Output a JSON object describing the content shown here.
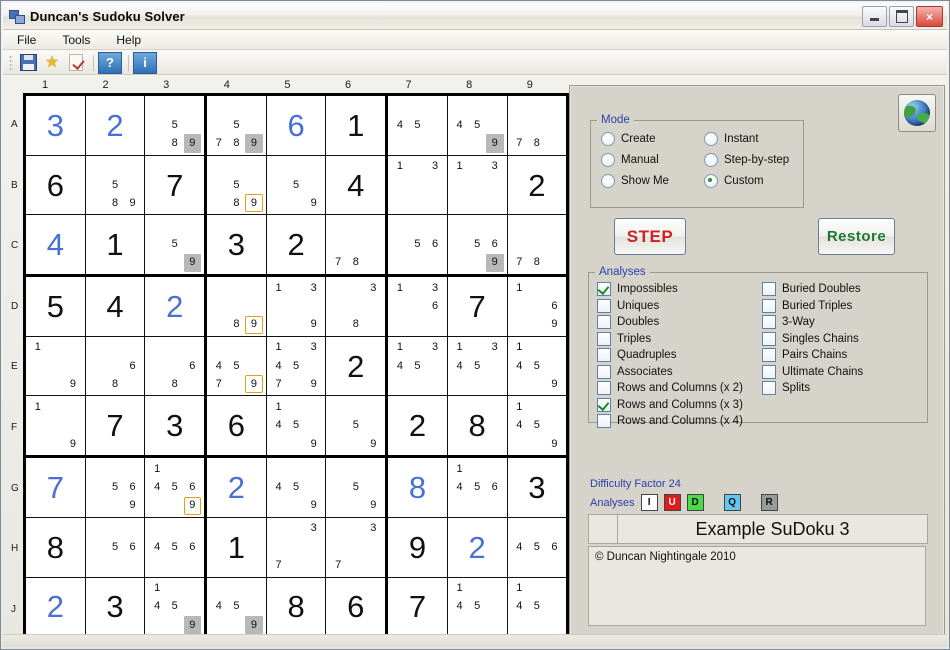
{
  "window": {
    "title": "Duncan's Sudoku Solver",
    "icon": "app-icon",
    "minimize": "minimize",
    "maximize": "maximize",
    "close": "×"
  },
  "menu": {
    "items": [
      {
        "label": "File"
      },
      {
        "label": "Tools"
      },
      {
        "label": "Help"
      }
    ]
  },
  "toolbar": {
    "buttons": [
      {
        "name": "save-icon",
        "label": ""
      },
      {
        "name": "star-icon",
        "label": ""
      },
      {
        "name": "page-check-icon",
        "label": ""
      },
      {
        "name": "help-button",
        "label": "?"
      },
      {
        "name": "info-button",
        "label": "i"
      }
    ]
  },
  "grid": {
    "column_labels": [
      "1",
      "2",
      "3",
      "4",
      "5",
      "6",
      "7",
      "8",
      "9"
    ],
    "row_labels": [
      "A",
      "B",
      "C",
      "D",
      "E",
      "F",
      "G",
      "H",
      "J"
    ],
    "cells": [
      [
        {
          "value": "3",
          "given": true
        },
        {
          "value": "2",
          "given": true
        },
        {
          "candidates": {
            "5": "plain",
            "8": "plain",
            "9": "gray"
          }
        },
        {
          "candidates": {
            "5": "plain",
            "7": "plain",
            "8": "plain",
            "9": "gray"
          }
        },
        {
          "value": "6",
          "given": true
        },
        {
          "value": "1"
        },
        {
          "candidates": {
            "4": "plain",
            "5": "plain"
          }
        },
        {
          "candidates": {
            "4": "plain",
            "5": "plain",
            "9": "gray"
          }
        },
        {
          "candidates": {
            "7": "plain",
            "8": "plain"
          }
        }
      ],
      [
        {
          "value": "6"
        },
        {
          "candidates": {
            "5": "plain",
            "8": "plain",
            "9": "plain"
          }
        },
        {
          "value": "7"
        },
        {
          "candidates": {
            "5": "plain",
            "8": "plain",
            "9": "box"
          }
        },
        {
          "candidates": {
            "5": "plain",
            "9": "plain"
          }
        },
        {
          "value": "4"
        },
        {
          "candidates": {
            "1": "plain",
            "3": "plain"
          }
        },
        {
          "candidates": {
            "1": "plain",
            "3": "plain"
          }
        },
        {
          "value": "2"
        }
      ],
      [
        {
          "value": "4",
          "given": true
        },
        {
          "value": "1"
        },
        {
          "candidates": {
            "5": "plain",
            "9": "gray"
          }
        },
        {
          "value": "3"
        },
        {
          "value": "2"
        },
        {
          "candidates": {
            "7": "plain",
            "8": "plain"
          }
        },
        {
          "candidates": {
            "5": "plain",
            "6": "plain"
          }
        },
        {
          "candidates": {
            "5": "plain",
            "6": "plain",
            "9": "gray"
          }
        },
        {
          "candidates": {
            "7": "plain",
            "8": "plain"
          }
        }
      ],
      [
        {
          "value": "5"
        },
        {
          "value": "4"
        },
        {
          "value": "2",
          "given": true
        },
        {
          "candidates": {
            "8": "plain",
            "9": "box"
          }
        },
        {
          "candidates": {
            "1": "plain",
            "3": "plain",
            "9": "plain"
          }
        },
        {
          "candidates": {
            "3": "plain",
            "8": "plain"
          }
        },
        {
          "candidates": {
            "1": "plain",
            "3": "plain",
            "6": "plain"
          }
        },
        {
          "value": "7"
        },
        {
          "candidates": {
            "1": "plain",
            "6": "plain",
            "9": "plain"
          }
        }
      ],
      [
        {
          "candidates": {
            "1": "plain",
            "9": "plain"
          }
        },
        {
          "candidates": {
            "6": "plain",
            "8": "plain"
          }
        },
        {
          "candidates": {
            "6": "plain",
            "8": "plain"
          }
        },
        {
          "candidates": {
            "4": "plain",
            "5": "plain",
            "7": "plain",
            "9": "box"
          }
        },
        {
          "candidates": {
            "1": "plain",
            "3": "plain",
            "4": "plain",
            "5": "plain",
            "7": "plain",
            "9": "plain"
          }
        },
        {
          "value": "2"
        },
        {
          "candidates": {
            "1": "plain",
            "3": "plain",
            "4": "plain",
            "5": "plain"
          }
        },
        {
          "candidates": {
            "1": "plain",
            "3": "plain",
            "4": "plain",
            "5": "plain"
          }
        },
        {
          "candidates": {
            "1": "plain",
            "4": "plain",
            "5": "plain",
            "9": "plain"
          }
        }
      ],
      [
        {
          "candidates": {
            "1": "plain",
            "9": "plain"
          }
        },
        {
          "value": "7"
        },
        {
          "value": "3"
        },
        {
          "value": "6"
        },
        {
          "candidates": {
            "1": "plain",
            "4": "plain",
            "5": "plain",
            "9": "plain"
          }
        },
        {
          "candidates": {
            "5": "plain",
            "9": "plain"
          }
        },
        {
          "value": "2"
        },
        {
          "value": "8"
        },
        {
          "candidates": {
            "1": "plain",
            "4": "plain",
            "5": "plain",
            "9": "plain"
          }
        }
      ],
      [
        {
          "value": "7",
          "given": true
        },
        {
          "candidates": {
            "5": "plain",
            "6": "plain",
            "9": "plain"
          }
        },
        {
          "candidates": {
            "1": "plain",
            "4": "plain",
            "5": "plain",
            "6": "plain",
            "9": "box"
          }
        },
        {
          "value": "2",
          "given": true
        },
        {
          "candidates": {
            "4": "plain",
            "5": "plain",
            "9": "plain"
          }
        },
        {
          "candidates": {
            "5": "plain",
            "9": "plain"
          }
        },
        {
          "value": "8",
          "given": true
        },
        {
          "candidates": {
            "1": "plain",
            "4": "plain",
            "5": "plain",
            "6": "plain"
          }
        },
        {
          "value": "3"
        }
      ],
      [
        {
          "value": "8"
        },
        {
          "candidates": {
            "5": "plain",
            "6": "plain"
          }
        },
        {
          "candidates": {
            "4": "plain",
            "5": "plain",
            "6": "plain"
          }
        },
        {
          "value": "1"
        },
        {
          "candidates": {
            "3": "plain",
            "7": "plain"
          }
        },
        {
          "candidates": {
            "3": "plain",
            "7": "plain"
          }
        },
        {
          "value": "9"
        },
        {
          "value": "2",
          "given": true
        },
        {
          "candidates": {
            "4": "plain",
            "5": "plain",
            "6": "plain"
          }
        }
      ],
      [
        {
          "value": "2",
          "given": true
        },
        {
          "value": "3"
        },
        {
          "candidates": {
            "1": "plain",
            "4": "plain",
            "5": "plain",
            "9": "gray"
          }
        },
        {
          "candidates": {
            "4": "plain",
            "5": "plain",
            "9": "gray"
          }
        },
        {
          "value": "8"
        },
        {
          "value": "6"
        },
        {
          "value": "7"
        },
        {
          "candidates": {
            "1": "plain",
            "4": "plain",
            "5": "plain"
          }
        },
        {
          "candidates": {
            "1": "plain",
            "4": "plain",
            "5": "plain"
          }
        }
      ]
    ]
  },
  "panel": {
    "globe_button": "globe-button",
    "mode": {
      "legend": "Mode",
      "options": [
        {
          "label": "Create",
          "selected": false
        },
        {
          "label": "Instant",
          "selected": false
        },
        {
          "label": "Manual",
          "selected": false
        },
        {
          "label": "Step-by-step",
          "selected": false
        },
        {
          "label": "Show Me",
          "selected": false
        },
        {
          "label": "Custom",
          "selected": true
        }
      ]
    },
    "step_button": "STEP",
    "restore_button": "Restore",
    "analyses": {
      "legend": "Analyses",
      "left_column": [
        {
          "label": "Impossibles",
          "checked": true
        },
        {
          "label": "Uniques",
          "checked": false
        },
        {
          "label": "Doubles",
          "checked": false
        },
        {
          "label": "Triples",
          "checked": false
        },
        {
          "label": "Quadruples",
          "checked": false
        },
        {
          "label": "Associates",
          "checked": false
        },
        {
          "label": "Rows and Columns (x 2)",
          "checked": false
        },
        {
          "label": "Rows and Columns (x 3)",
          "checked": true
        },
        {
          "label": "Rows and Columns (x 4)",
          "checked": false
        }
      ],
      "right_column": [
        {
          "label": "Buried Doubles",
          "checked": false
        },
        {
          "label": "Buried Triples",
          "checked": false
        },
        {
          "label": "3-Way",
          "checked": false
        },
        {
          "label": "Singles Chains",
          "checked": false
        },
        {
          "label": "Pairs Chains",
          "checked": false
        },
        {
          "label": "Ultimate Chains",
          "checked": false
        },
        {
          "label": "Splits",
          "checked": false
        }
      ]
    },
    "difficulty_label": "Difficulty Factor 24",
    "analyses_legend_label": "Analyses",
    "analyses_badges": [
      {
        "letter": "I",
        "bg": "#ffffff",
        "fg": "#111111",
        "gap": false
      },
      {
        "letter": "U",
        "bg": "#e01b1b",
        "fg": "#ffffff",
        "gap": false
      },
      {
        "letter": "D",
        "bg": "#4cd94c",
        "fg": "#111111",
        "gap": false
      },
      {
        "letter": "Q",
        "bg": "#63c8f0",
        "fg": "#111111",
        "gap": true
      },
      {
        "letter": "R",
        "bg": "#9a9a9a",
        "fg": "#111111",
        "gap": true
      }
    ],
    "puzzle_title": "Example SuDoku 3",
    "note": "© Duncan Nightingale 2010"
  },
  "colors": {
    "given_number": "#4a6fd6",
    "solved_number": "#111111",
    "legend_blue": "#2b3fa8",
    "step_red": "#cc2222",
    "restore_green": "#1d7a33",
    "highlight_gray": "#b8b8b8",
    "highlight_box": "#e0a21a"
  }
}
